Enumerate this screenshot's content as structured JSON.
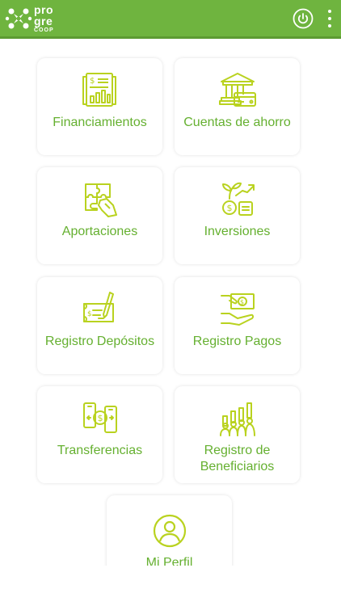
{
  "app": {
    "brand_line1": "pro",
    "brand_line2": "gre",
    "brand_line3": "COOP",
    "accent_color": "#6fb43f",
    "label_color": "#65b030",
    "icon_color": "#b9d21f"
  },
  "header": {
    "power_icon": "power-icon",
    "menu_icon": "more-vertical-icon"
  },
  "menu": {
    "items": [
      {
        "id": "financiamientos",
        "label": "Financiamientos",
        "icon": "invoice-chart-icon"
      },
      {
        "id": "cuentas",
        "label": "Cuentas de ahorro",
        "icon": "bank-card-icon"
      },
      {
        "id": "aportaciones",
        "label": "Aportaciones",
        "icon": "puzzle-hand-icon"
      },
      {
        "id": "inversiones",
        "label": "Inversiones",
        "icon": "plant-growth-coins-icon"
      },
      {
        "id": "depositos",
        "label": "Registro Depósitos",
        "icon": "check-pen-icon"
      },
      {
        "id": "pagos",
        "label": "Registro Pagos",
        "icon": "hand-money-icon"
      },
      {
        "id": "transferencias",
        "label": "Transferencias",
        "icon": "phones-transfer-icon"
      },
      {
        "id": "beneficiarios",
        "label": "Registro de Beneficiarios",
        "icon": "people-growth-icon"
      },
      {
        "id": "perfil",
        "label": "Mi Perfil",
        "icon": "user-circle-icon"
      }
    ]
  }
}
